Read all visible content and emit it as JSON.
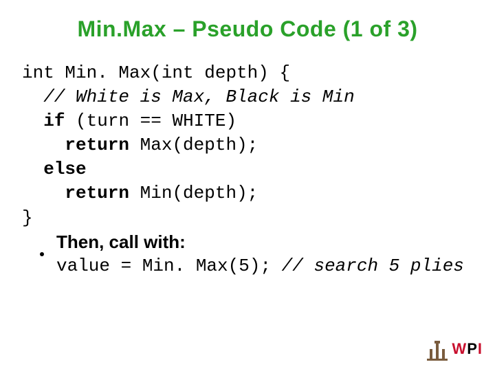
{
  "title": "Min.Max – Pseudo Code (1 of 3)",
  "code": {
    "l1": "int Min. Max(int depth) {",
    "l2_cm": "  // White is Max, Black is Min",
    "l3_a": "  ",
    "l3_kw": "if",
    "l3_b": " (turn == WHITE)",
    "l4_a": "    ",
    "l4_kw": "return",
    "l4_b": " Max(depth);",
    "l5_a": "  ",
    "l5_kw": "else",
    "l6_a": "    ",
    "l6_kw": "return",
    "l6_b": " Min(depth);",
    "l7": "}"
  },
  "bullet": "Then, call with:",
  "call": {
    "a": "value = Min. Max(5); ",
    "cm": "// search 5 plies"
  },
  "logo": {
    "w": "W",
    "p": "P",
    "i": "I"
  }
}
